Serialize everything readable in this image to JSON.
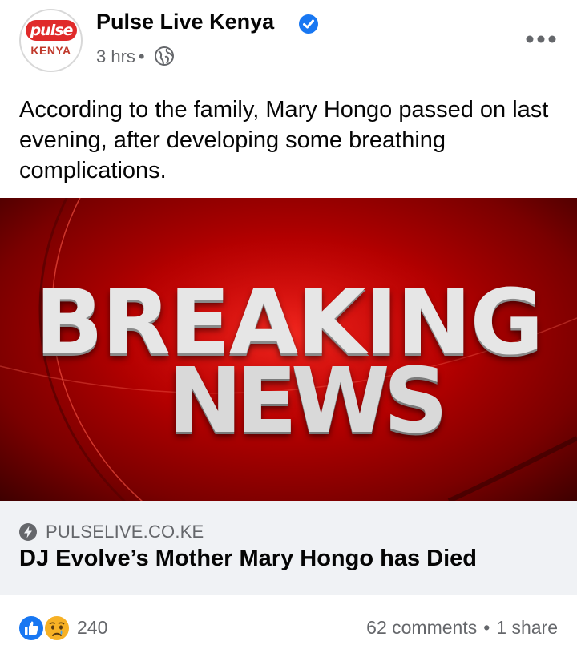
{
  "post": {
    "page_name": "Pulse Live Kenya",
    "timestamp": "3 hrs",
    "separator": "•",
    "avatar_logo_top": "pulse",
    "avatar_logo_bottom": "KENYA",
    "caption": "According to the family, Mary Hongo passed on last evening, after developing some breathing complications."
  },
  "hero_image": {
    "line1": "BREAKING",
    "line2": "NEWS"
  },
  "link_preview": {
    "domain": "PULSELIVE.CO.KE",
    "title": "DJ Evolve’s Mother Mary Hongo has Died"
  },
  "footer": {
    "reaction_count": "240",
    "comments": "62 comments",
    "separator": "•",
    "shares": "1 share"
  },
  "colors": {
    "verified": "#1877f2",
    "like": "#1877f2",
    "secondary_text": "#65676b",
    "link_box_bg": "#f0f2f5",
    "brand_red": "#e02b2b"
  },
  "icons": [
    "verified-badge-icon",
    "globe-icon",
    "more-options-icon",
    "lightning-bolt-icon",
    "like-reaction-icon",
    "sad-reaction-icon"
  ]
}
